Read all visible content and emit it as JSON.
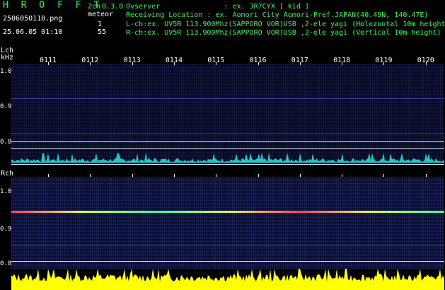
{
  "header": {
    "app_title": "H R O F F T",
    "channels": "2ch",
    "version": "0.3.0",
    "filename": "2506050110.png",
    "meteor_label": "meteor",
    "meteor_count_l": "1",
    "meteor_count_r": "55",
    "datetime": "25.06.05 01:10",
    "observer_line": "Ovserver               : ex. JR7CYX [ kid ]",
    "location_line": "Receiving Location : ex. Aomori City Aomori-Pref.JAPAN(40.49N, 140.47E)",
    "lch_line": "L-ch:ex. UV5R 113.900Mhz(SAPPORO VOR)USB ,2-ele yagi (Holozontal 10m height)",
    "rch_line": "R-ch:ex. UV5R 113.900Mhz(SAPPORO VOR)USB ,2-ele yagi (Vertical 10m height)"
  },
  "time_ticks": [
    "0111",
    "0112",
    "0113",
    "0114",
    "0115",
    "0116",
    "0117",
    "0118",
    "0119",
    "0120"
  ],
  "lch": {
    "label": "Lch",
    "unit": "kHz",
    "freq_ticks": [
      "1.0",
      "0.9",
      "0.8"
    ]
  },
  "rch": {
    "label": "Rch",
    "freq_ticks": [
      "1.0",
      "0.9",
      "0.8"
    ]
  },
  "colors": {
    "text_green": "#20ff40",
    "waterfall_bg": "#05071a",
    "lch_amplitude": "#20c8c8",
    "rch_amplitude": "#ffff00",
    "carrier": "#e0ff40"
  }
}
